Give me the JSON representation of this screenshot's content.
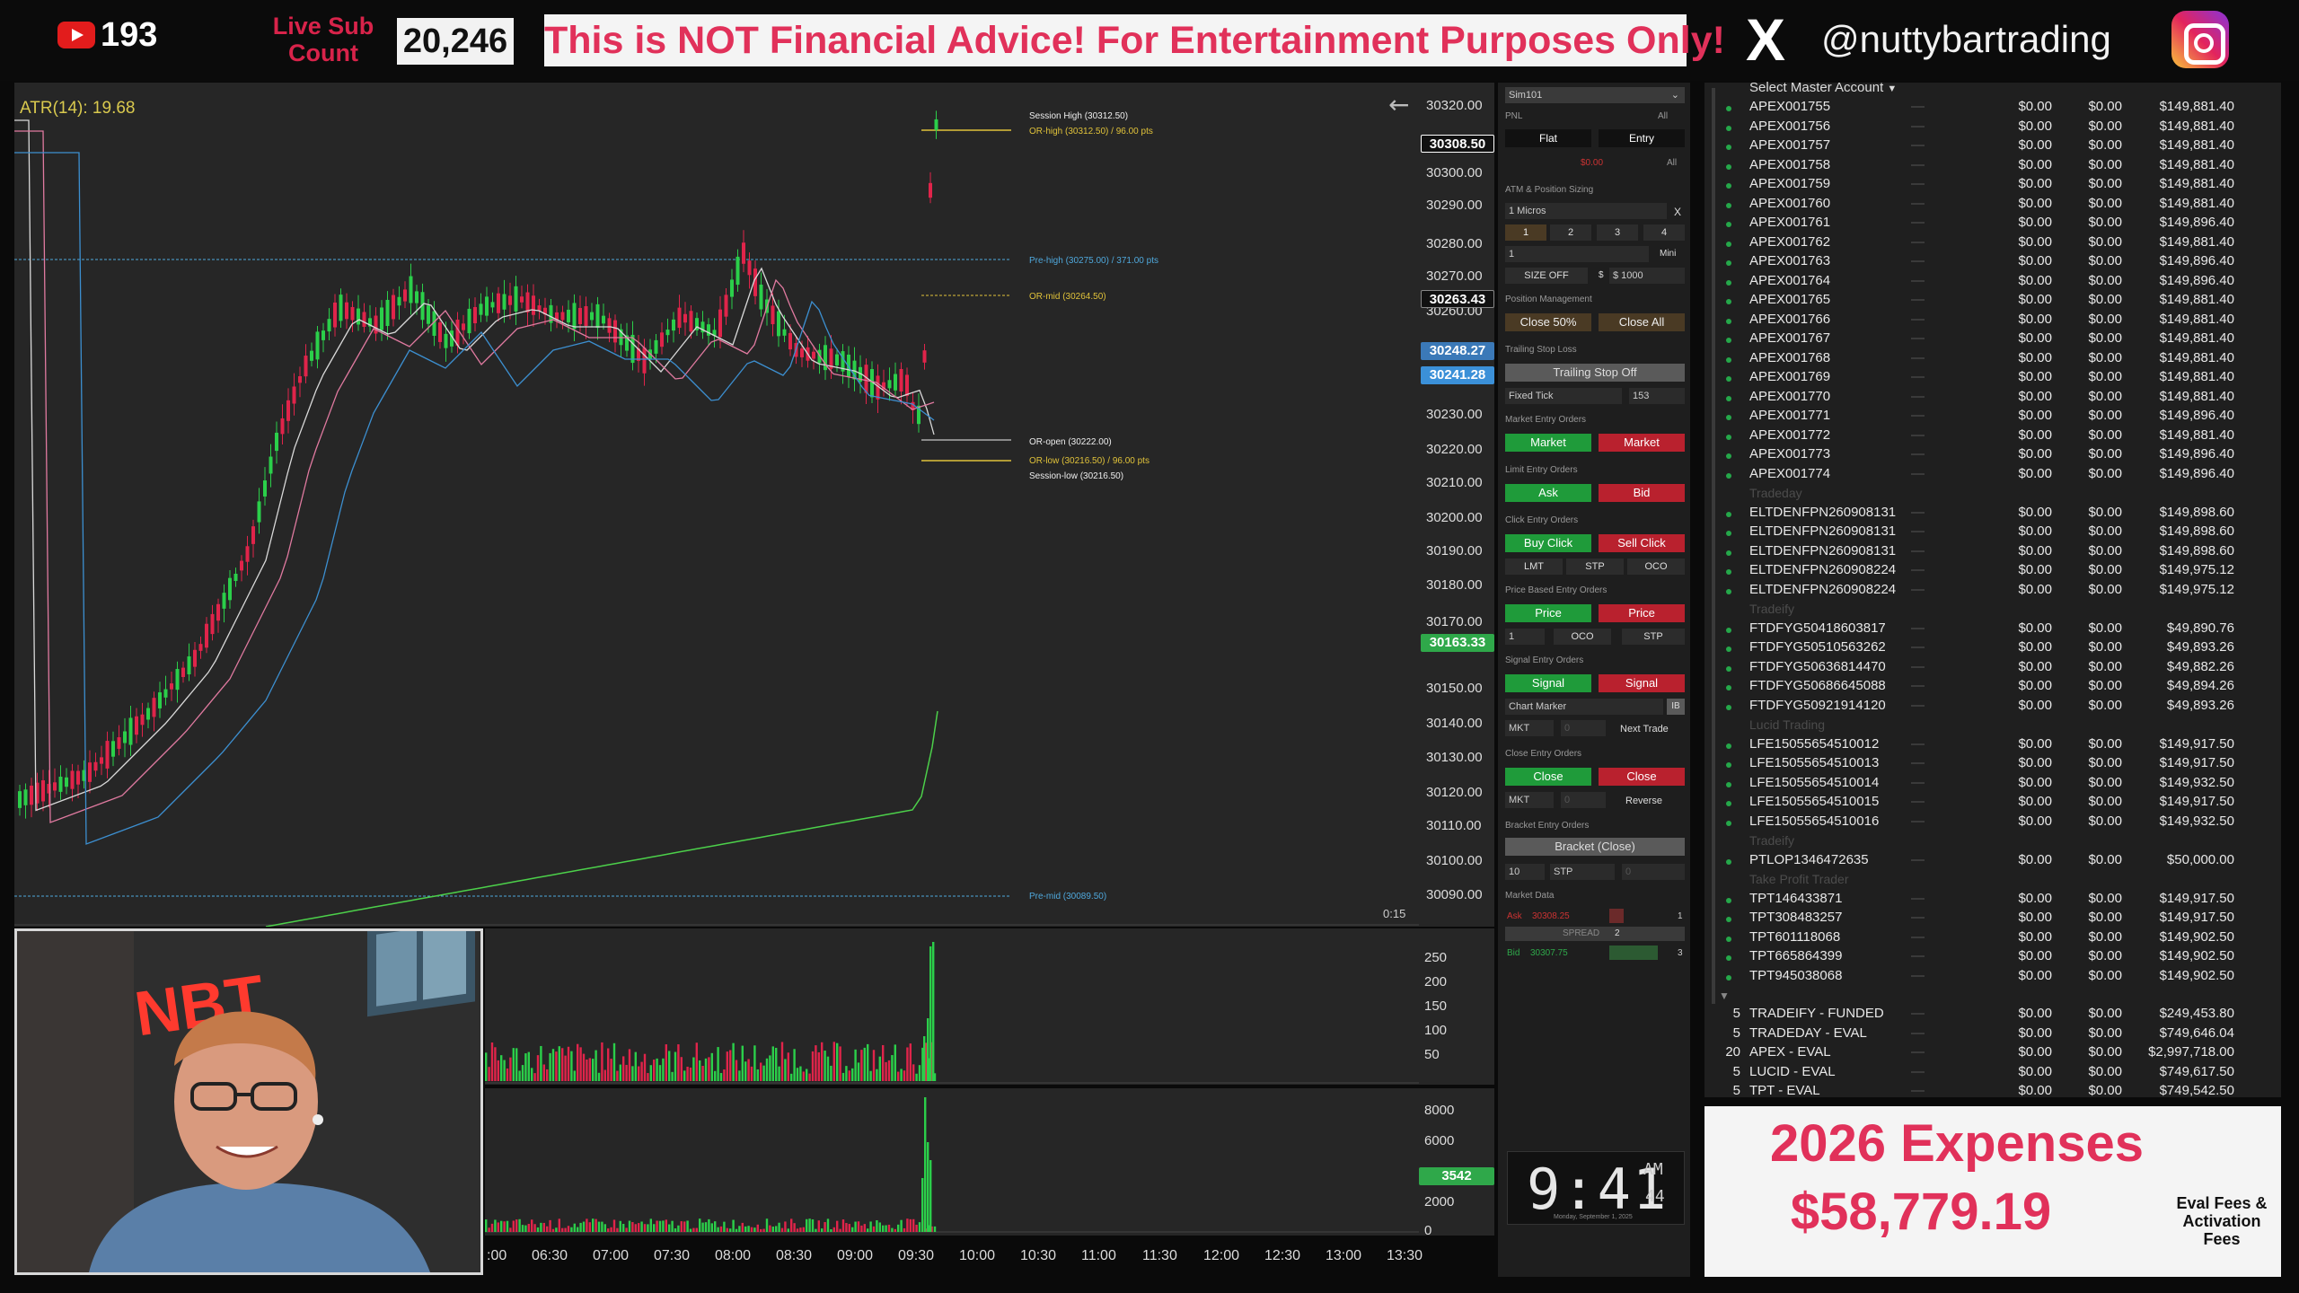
{
  "topbar": {
    "yt_count": "193",
    "live_sub_line1": "Live Sub",
    "live_sub_line2": "Count",
    "sub_count": "20,246",
    "disclaimer": "This is NOT Financial Advice! For Entertainment Purposes Only!",
    "x_logo": "X",
    "handle": "@nuttybartrading"
  },
  "chart": {
    "atr": "ATR(14): 19.68",
    "timer": "0:15",
    "prices": [
      "30320.00",
      "30300.00",
      "30290.00",
      "30280.00",
      "30270.00",
      "30260.00",
      "30230.00",
      "30220.00",
      "30210.00",
      "30200.00",
      "30190.00",
      "30180.00",
      "30170.00",
      "30150.00",
      "30140.00",
      "30130.00",
      "30120.00",
      "30110.00",
      "30100.00",
      "30090.00"
    ],
    "tag_last": "30308.50",
    "tag_a": "30263.43",
    "tag_b": "30248.27",
    "tag_c": "30241.28",
    "tag_d": "30163.33",
    "ann_session_high": "Session High (30312.50)",
    "ann_or_high": "OR-high (30312.50) / 96.00 pts",
    "ann_pre_high": "Pre-high (30275.00) / 371.00 pts",
    "ann_or_mid": "OR-mid (30264.50)",
    "ann_or_open": "OR-open (30222.00)",
    "ann_or_low": "OR-low (30216.50) / 96.00 pts",
    "ann_session_low": "Session-low (30216.50)",
    "ann_pre_mid": "Pre-mid (30089.50)"
  },
  "volume": {
    "labels1": [
      "250",
      "200",
      "150",
      "100",
      "50"
    ],
    "labels2": [
      "8000",
      "6000",
      "2000",
      "0"
    ],
    "tag": "3542",
    "times": [
      ":00",
      "06:30",
      "07:00",
      "07:30",
      "08:00",
      "08:30",
      "09:00",
      "09:30",
      "10:00",
      "10:30",
      "11:00",
      "11:30",
      "12:00",
      "12:30",
      "13:00",
      "13:30"
    ]
  },
  "webcam": {
    "sign": "NBT"
  },
  "panel": {
    "account": "Sim101",
    "pnl": "PNL",
    "all": "All",
    "flat": "Flat",
    "entry": "Entry",
    "pnl_value": "$0.00",
    "atm_title": "ATM & Position Sizing",
    "atm_value": "1 Micros",
    "x": "X",
    "qty1": "1",
    "qty2": "2",
    "qty3": "3",
    "qty4": "4",
    "qty_field": "1",
    "mini": "Mini",
    "size_off": "SIZE OFF",
    "dollar": "$",
    "size_amount": "$ 1000",
    "pos_mgmt": "Position Management",
    "close50": "Close 50%",
    "close_all": "Close All",
    "trailing_title": "Trailing Stop Loss",
    "trailing_btn": "Trailing Stop Off",
    "fixed_tick": "Fixed Tick",
    "tick_val": "153",
    "market_title": "Market Entry Orders",
    "market": "Market",
    "limit_title": "Limit Entry Orders",
    "ask": "Ask",
    "bid": "Bid",
    "click_title": "Click Entry Orders",
    "buy_click": "Buy Click",
    "sell_click": "Sell Click",
    "lmt": "LMT",
    "stp": "STP",
    "oco": "OCO",
    "price_title": "Price Based Entry Orders",
    "price": "Price",
    "one": "1",
    "signal_title": "Signal Entry Orders",
    "signal": "Signal",
    "chart_marker": "Chart Marker",
    "ib": "IB",
    "mkt": "MKT",
    "zero": "0",
    "next_trade": "Next Trade",
    "close_title": "Close Entry Orders",
    "close": "Close",
    "reverse": "Reverse",
    "bracket_title": "Bracket Entry Orders",
    "bracket": "Bracket (Close)",
    "ten": "10",
    "md_title": "Market Data",
    "md_ask": "Ask",
    "md_ask_val": "30308.25",
    "md_ask_sz": "1",
    "spread": "SPREAD",
    "spread_val": "2",
    "md_bid": "Bid",
    "md_bid_val": "30307.75",
    "md_bid_sz": "3"
  },
  "clock": {
    "time": "9:41",
    "ampm": "AM",
    "sec": "44",
    "date": "Monday, September 1, 2025"
  },
  "accounts": {
    "header": "Select Master Account",
    "dash": "—",
    "rows": [
      {
        "name": "APEX001755",
        "a": "$0.00",
        "b": "$0.00",
        "bal": "$149,881.40"
      },
      {
        "name": "APEX001756",
        "a": "$0.00",
        "b": "$0.00",
        "bal": "$149,881.40"
      },
      {
        "name": "APEX001757",
        "a": "$0.00",
        "b": "$0.00",
        "bal": "$149,881.40"
      },
      {
        "name": "APEX001758",
        "a": "$0.00",
        "b": "$0.00",
        "bal": "$149,881.40"
      },
      {
        "name": "APEX001759",
        "a": "$0.00",
        "b": "$0.00",
        "bal": "$149,881.40"
      },
      {
        "name": "APEX001760",
        "a": "$0.00",
        "b": "$0.00",
        "bal": "$149,881.40"
      },
      {
        "name": "APEX001761",
        "a": "$0.00",
        "b": "$0.00",
        "bal": "$149,896.40"
      },
      {
        "name": "APEX001762",
        "a": "$0.00",
        "b": "$0.00",
        "bal": "$149,881.40"
      },
      {
        "name": "APEX001763",
        "a": "$0.00",
        "b": "$0.00",
        "bal": "$149,896.40"
      },
      {
        "name": "APEX001764",
        "a": "$0.00",
        "b": "$0.00",
        "bal": "$149,896.40"
      },
      {
        "name": "APEX001765",
        "a": "$0.00",
        "b": "$0.00",
        "bal": "$149,881.40"
      },
      {
        "name": "APEX001766",
        "a": "$0.00",
        "b": "$0.00",
        "bal": "$149,881.40"
      },
      {
        "name": "APEX001767",
        "a": "$0.00",
        "b": "$0.00",
        "bal": "$149,881.40"
      },
      {
        "name": "APEX001768",
        "a": "$0.00",
        "b": "$0.00",
        "bal": "$149,881.40"
      },
      {
        "name": "APEX001769",
        "a": "$0.00",
        "b": "$0.00",
        "bal": "$149,881.40"
      },
      {
        "name": "APEX001770",
        "a": "$0.00",
        "b": "$0.00",
        "bal": "$149,881.40"
      },
      {
        "name": "APEX001771",
        "a": "$0.00",
        "b": "$0.00",
        "bal": "$149,896.40"
      },
      {
        "name": "APEX001772",
        "a": "$0.00",
        "b": "$0.00",
        "bal": "$149,881.40"
      },
      {
        "name": "APEX001773",
        "a": "$0.00",
        "b": "$0.00",
        "bal": "$149,896.40"
      },
      {
        "name": "APEX001774",
        "a": "$0.00",
        "b": "$0.00",
        "bal": "$149,896.40"
      },
      {
        "group": "Tradeday"
      },
      {
        "name": "ELTDENFPN260908131",
        "a": "$0.00",
        "b": "$0.00",
        "bal": "$149,898.60"
      },
      {
        "name": "ELTDENFPN260908131",
        "a": "$0.00",
        "b": "$0.00",
        "bal": "$149,898.60"
      },
      {
        "name": "ELTDENFPN260908131",
        "a": "$0.00",
        "b": "$0.00",
        "bal": "$149,898.60"
      },
      {
        "name": "ELTDENFPN260908224",
        "a": "$0.00",
        "b": "$0.00",
        "bal": "$149,975.12"
      },
      {
        "name": "ELTDENFPN260908224",
        "a": "$0.00",
        "b": "$0.00",
        "bal": "$149,975.12"
      },
      {
        "group": "Tradeify"
      },
      {
        "name": "FTDFYG50418603817",
        "a": "$0.00",
        "b": "$0.00",
        "bal": "$49,890.76"
      },
      {
        "name": "FTDFYG50510563262",
        "a": "$0.00",
        "b": "$0.00",
        "bal": "$49,893.26"
      },
      {
        "name": "FTDFYG50636814470",
        "a": "$0.00",
        "b": "$0.00",
        "bal": "$49,882.26"
      },
      {
        "name": "FTDFYG50686645088",
        "a": "$0.00",
        "b": "$0.00",
        "bal": "$49,894.26"
      },
      {
        "name": "FTDFYG50921914120",
        "a": "$0.00",
        "b": "$0.00",
        "bal": "$49,893.26"
      },
      {
        "group": "Lucid Trading"
      },
      {
        "name": "LFE15055654510012",
        "a": "$0.00",
        "b": "$0.00",
        "bal": "$149,917.50"
      },
      {
        "name": "LFE15055654510013",
        "a": "$0.00",
        "b": "$0.00",
        "bal": "$149,917.50"
      },
      {
        "name": "LFE15055654510014",
        "a": "$0.00",
        "b": "$0.00",
        "bal": "$149,932.50"
      },
      {
        "name": "LFE15055654510015",
        "a": "$0.00",
        "b": "$0.00",
        "bal": "$149,917.50"
      },
      {
        "name": "LFE15055654510016",
        "a": "$0.00",
        "b": "$0.00",
        "bal": "$149,932.50"
      },
      {
        "group": "Tradeify"
      },
      {
        "name": "PTLOP1346472635",
        "a": "$0.00",
        "b": "$0.00",
        "bal": "$50,000.00"
      },
      {
        "group": "Take Profit Trader"
      },
      {
        "name": "TPT146433871",
        "a": "$0.00",
        "b": "$0.00",
        "bal": "$149,917.50"
      },
      {
        "name": "TPT308483257",
        "a": "$0.00",
        "b": "$0.00",
        "bal": "$149,917.50"
      },
      {
        "name": "TPT601118068",
        "a": "$0.00",
        "b": "$0.00",
        "bal": "$149,902.50"
      },
      {
        "name": "TPT665864399",
        "a": "$0.00",
        "b": "$0.00",
        "bal": "$149,902.50"
      },
      {
        "name": "TPT945038068",
        "a": "$0.00",
        "b": "$0.00",
        "bal": "$149,902.50"
      }
    ],
    "summary": [
      {
        "n": "5",
        "name": "TRADEIFY - FUNDED",
        "a": "$0.00",
        "b": "$0.00",
        "bal": "$249,453.80"
      },
      {
        "n": "5",
        "name": "TRADEDAY - EVAL",
        "a": "$0.00",
        "b": "$0.00",
        "bal": "$749,646.04"
      },
      {
        "n": "20",
        "name": "APEX - EVAL",
        "a": "$0.00",
        "b": "$0.00",
        "bal": "$2,997,718.00"
      },
      {
        "n": "5",
        "name": "LUCID - EVAL",
        "a": "$0.00",
        "b": "$0.00",
        "bal": "$749,617.50"
      },
      {
        "n": "5",
        "name": "TPT - EVAL",
        "a": "$0.00",
        "b": "$0.00",
        "bal": "$749,542.50"
      }
    ]
  },
  "expenses": {
    "title": "2026 Expenses",
    "amount": "$58,779.19",
    "note": "Eval Fees & Activation Fees"
  },
  "colors": {
    "accent": "#e1315a",
    "buy": "#1f9b3a",
    "sell": "#b9212e",
    "chart_bg": "#262626"
  }
}
